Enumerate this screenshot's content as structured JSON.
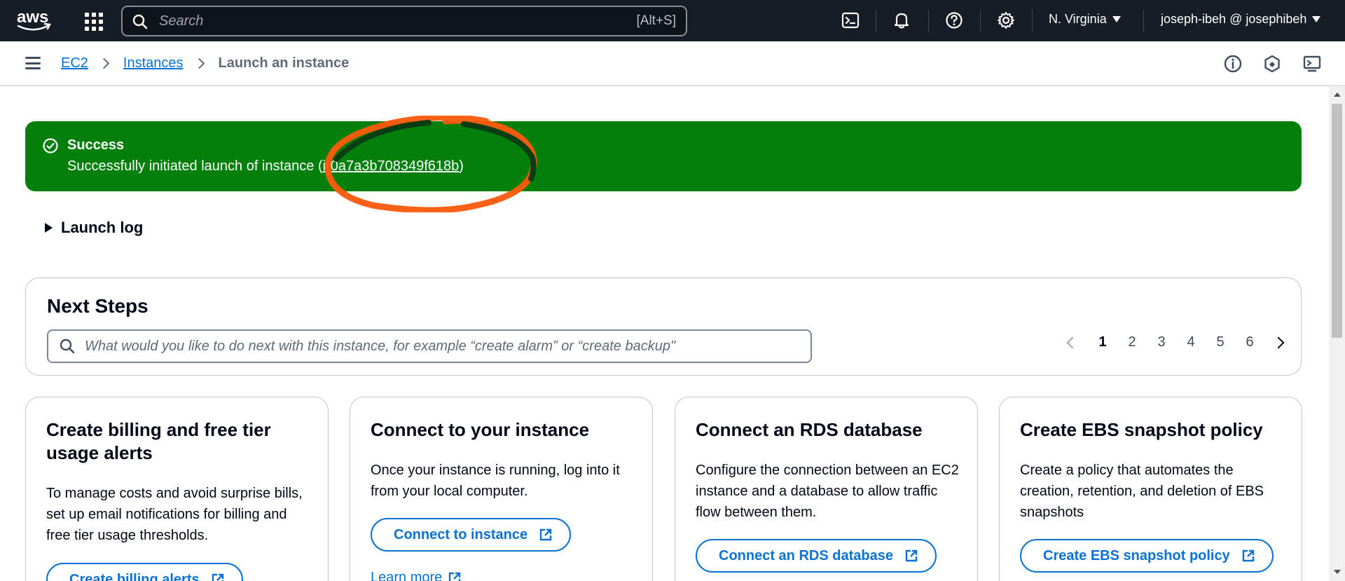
{
  "topnav": {
    "logo_text": "aws",
    "search_placeholder": "Search",
    "search_shortcut": "[Alt+S]",
    "region": "N. Virginia",
    "user": "joseph-ibeh @ josephibeh"
  },
  "breadcrumb": {
    "items": [
      "EC2",
      "Instances"
    ],
    "current": "Launch an instance"
  },
  "flash": {
    "title": "Success",
    "message_prefix": "Successfully initiated launch of instance (",
    "instance_id": "i-0a7a3b708349f618b",
    "message_suffix": ")",
    "color": "#037f0c"
  },
  "launch_log": {
    "label": "Launch log"
  },
  "next_steps": {
    "title": "Next Steps",
    "search_placeholder": "What would you like to do next with this instance, for example “create alarm” or “create backup\"",
    "pages": [
      "1",
      "2",
      "3",
      "4",
      "5",
      "6"
    ],
    "current_page": "1"
  },
  "cards": [
    {
      "title": "Create billing and free tier usage alerts",
      "description": "To manage costs and avoid surprise bills, set up email notifications for billing and free tier usage thresholds.",
      "button": "Create billing alerts"
    },
    {
      "title": "Connect to your instance",
      "description": "Once your instance is running, log into it from your local computer.",
      "button": "Connect to instance",
      "link": "Learn more"
    },
    {
      "title": "Connect an RDS database",
      "description": "Configure the connection between an EC2 instance and a database to allow traffic flow between them.",
      "button": "Connect an RDS database"
    },
    {
      "title": "Create EBS snapshot policy",
      "description": "Create a policy that automates the creation, retention, and deletion of EBS snapshots",
      "button": "Create EBS snapshot policy"
    }
  ],
  "colors": {
    "topnav_bg": "#161d26",
    "link_blue": "#0972d3",
    "success_green": "#037f0c",
    "annotation_dark": "#0a3d14",
    "annotation_orange": "#ff5a0a"
  },
  "icons": [
    "aws-logo",
    "apps-grid-icon",
    "search-icon",
    "cloudshell-icon",
    "bell-icon",
    "help-icon",
    "gear-icon",
    "menu-icon",
    "chevron-right-icon",
    "info-icon",
    "feedback-icon",
    "display-icon",
    "check-circle-icon",
    "caret-right-icon",
    "external-link-icon"
  ]
}
